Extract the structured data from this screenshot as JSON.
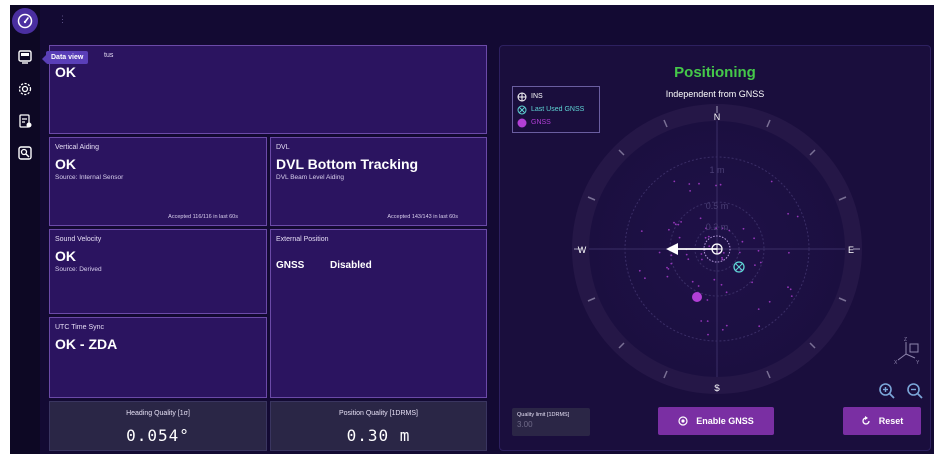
{
  "topbar": {
    "dots": "⋮"
  },
  "sidebar": {
    "tooltip": "Data view"
  },
  "panels": {
    "status": {
      "label_suffix": "tus",
      "value": "OK"
    },
    "vertical_aiding": {
      "label": "Vertical Aiding",
      "value": "OK",
      "source": "Source: Internal Sensor",
      "accepted": "Accepted 116/116 in last 60s"
    },
    "dvl": {
      "label": "DVL",
      "value": "DVL Bottom Tracking",
      "source": "DVL Beam Level Aiding",
      "accepted": "Accepted 143/143 in last 60s"
    },
    "sound_velocity": {
      "label": "Sound Velocity",
      "value": "OK",
      "source": "Source: Derived"
    },
    "external_position": {
      "label": "External Position",
      "gnss_label": "GNSS",
      "gnss_value": "Disabled"
    },
    "utc_time_sync": {
      "label": "UTC Time Sync",
      "value": "OK - ZDA"
    }
  },
  "quality": {
    "heading": {
      "label": "Heading Quality [1σ]",
      "value": "0.054°"
    },
    "position": {
      "label": "Position Quality [1DRMS]",
      "value": "0.30 m"
    }
  },
  "positioning": {
    "title": "Positioning",
    "subtitle": "Independent from GNSS",
    "legend": [
      {
        "label": "INS",
        "icon": "ins-icon",
        "color": "#ffffff"
      },
      {
        "label": "Last Used GNSS",
        "icon": "last-gnss-icon",
        "color": "#5fd6d6"
      },
      {
        "label": "GNSS",
        "icon": "gnss-icon",
        "color": "#b23fd6"
      }
    ],
    "cardinals": {
      "n": "N",
      "s": "S",
      "e": "E",
      "w": "W"
    },
    "rings": {
      "r1": "1 m",
      "r2": "0.5 m",
      "r3": "0.2 m"
    },
    "quality_limit": {
      "label": "Quality limit [1DRMS]",
      "value": "3.00"
    },
    "enable_gnss": "Enable GNSS",
    "reset": "Reset",
    "axis_labels": {
      "z": "Z",
      "x": "X",
      "y": "Y"
    }
  },
  "colors": {
    "accent": "#45c84a",
    "panel": "#2b1460",
    "button": "#7a2fa3",
    "gnss": "#b23fd6",
    "last_gnss": "#5fd6d6"
  }
}
